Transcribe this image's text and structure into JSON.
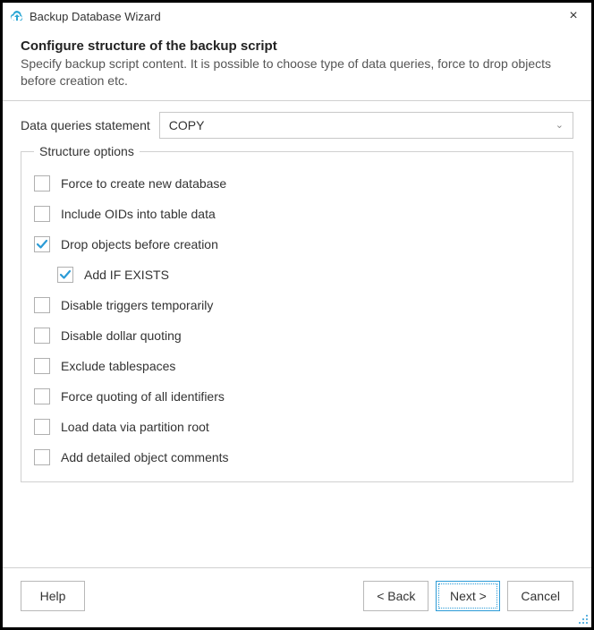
{
  "window": {
    "title": "Backup Database Wizard"
  },
  "header": {
    "title": "Configure structure of the backup script",
    "subtitle": "Specify backup script content. It is possible to choose type of data queries, force to drop objects before creation etc."
  },
  "queries": {
    "label": "Data queries statement",
    "value": "COPY"
  },
  "structure": {
    "legend": "Structure options",
    "items": [
      {
        "label": "Force to create new database",
        "checked": false,
        "indent": false
      },
      {
        "label": "Include OIDs into table data",
        "checked": false,
        "indent": false
      },
      {
        "label": "Drop objects before creation",
        "checked": true,
        "indent": false
      },
      {
        "label": "Add IF EXISTS",
        "checked": true,
        "indent": true
      },
      {
        "label": "Disable triggers temporarily",
        "checked": false,
        "indent": false
      },
      {
        "label": "Disable dollar quoting",
        "checked": false,
        "indent": false
      },
      {
        "label": "Exclude tablespaces",
        "checked": false,
        "indent": false
      },
      {
        "label": "Force quoting of all identifiers",
        "checked": false,
        "indent": false
      },
      {
        "label": "Load data via partition root",
        "checked": false,
        "indent": false
      },
      {
        "label": "Add detailed object comments",
        "checked": false,
        "indent": false
      }
    ]
  },
  "buttons": {
    "help": "Help",
    "back": "< Back",
    "next": "Next >",
    "cancel": "Cancel"
  }
}
